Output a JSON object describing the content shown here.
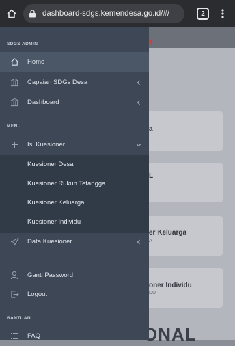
{
  "browser": {
    "url": "dashboard-sdgs.kemendesa.go.id/#/",
    "tab_count": "2"
  },
  "background": {
    "card_titles": [
      "a",
      "L",
      "er Keluarga",
      "oner Individu"
    ],
    "card_subs": [
      "",
      "",
      "A",
      "DU"
    ],
    "big_text": "ONAL"
  },
  "sidebar": {
    "sections": {
      "admin": "SDGS ADMIN",
      "menu": "MENU",
      "help": "BANTUAN"
    },
    "items": [
      {
        "label": "Home",
        "icon": "home-icon"
      },
      {
        "label": "Capaian SDGs Desa",
        "icon": "institution-icon"
      },
      {
        "label": "Dashboard",
        "icon": "institution-icon"
      },
      {
        "label": "Isi Kuesioner",
        "icon": "plus-icon"
      },
      {
        "label": "Data Kuesioner",
        "icon": "send-icon"
      },
      {
        "label": "Ganti Password",
        "icon": "user-icon"
      },
      {
        "label": "Logout",
        "icon": "logout-icon"
      },
      {
        "label": "FAQ",
        "icon": "list-icon"
      }
    ],
    "submenu": [
      "Kuesioner Desa",
      "Kuesioner Rukun Tetangga",
      "Kuesioner Keluarga",
      "Kuesioner Individu"
    ]
  },
  "colors": {
    "sidebar_bg": "#3d4756",
    "submenu_bg": "#313a47",
    "active_bg": "#4b5767",
    "browser_bar": "#2b2c30"
  }
}
